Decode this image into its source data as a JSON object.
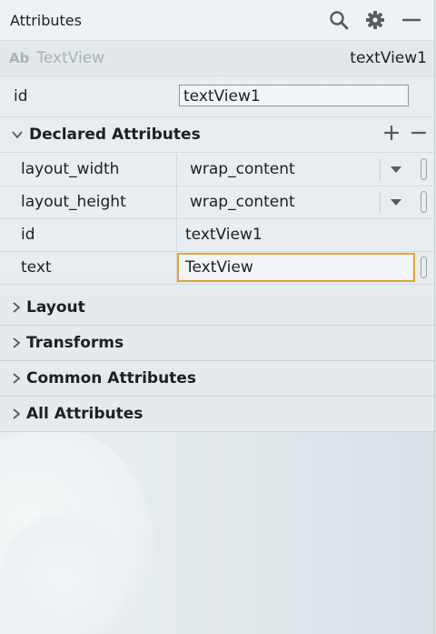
{
  "panel": {
    "title": "Attributes"
  },
  "component": {
    "badge": "Ab",
    "type": "TextView",
    "id": "textView1"
  },
  "id_field": {
    "label": "id",
    "value": "textView1"
  },
  "declared": {
    "title": "Declared Attributes",
    "rows": [
      {
        "name": "layout_width",
        "value": "wrap_content"
      },
      {
        "name": "layout_height",
        "value": "wrap_content"
      },
      {
        "name": "id",
        "value": "textView1"
      },
      {
        "name": "text",
        "value": "TextView"
      }
    ]
  },
  "sections": [
    "Layout",
    "Transforms",
    "Common Attributes",
    "All Attributes"
  ],
  "colors": {
    "focus_border": "#e0a43a",
    "background": "#e9eef1"
  }
}
